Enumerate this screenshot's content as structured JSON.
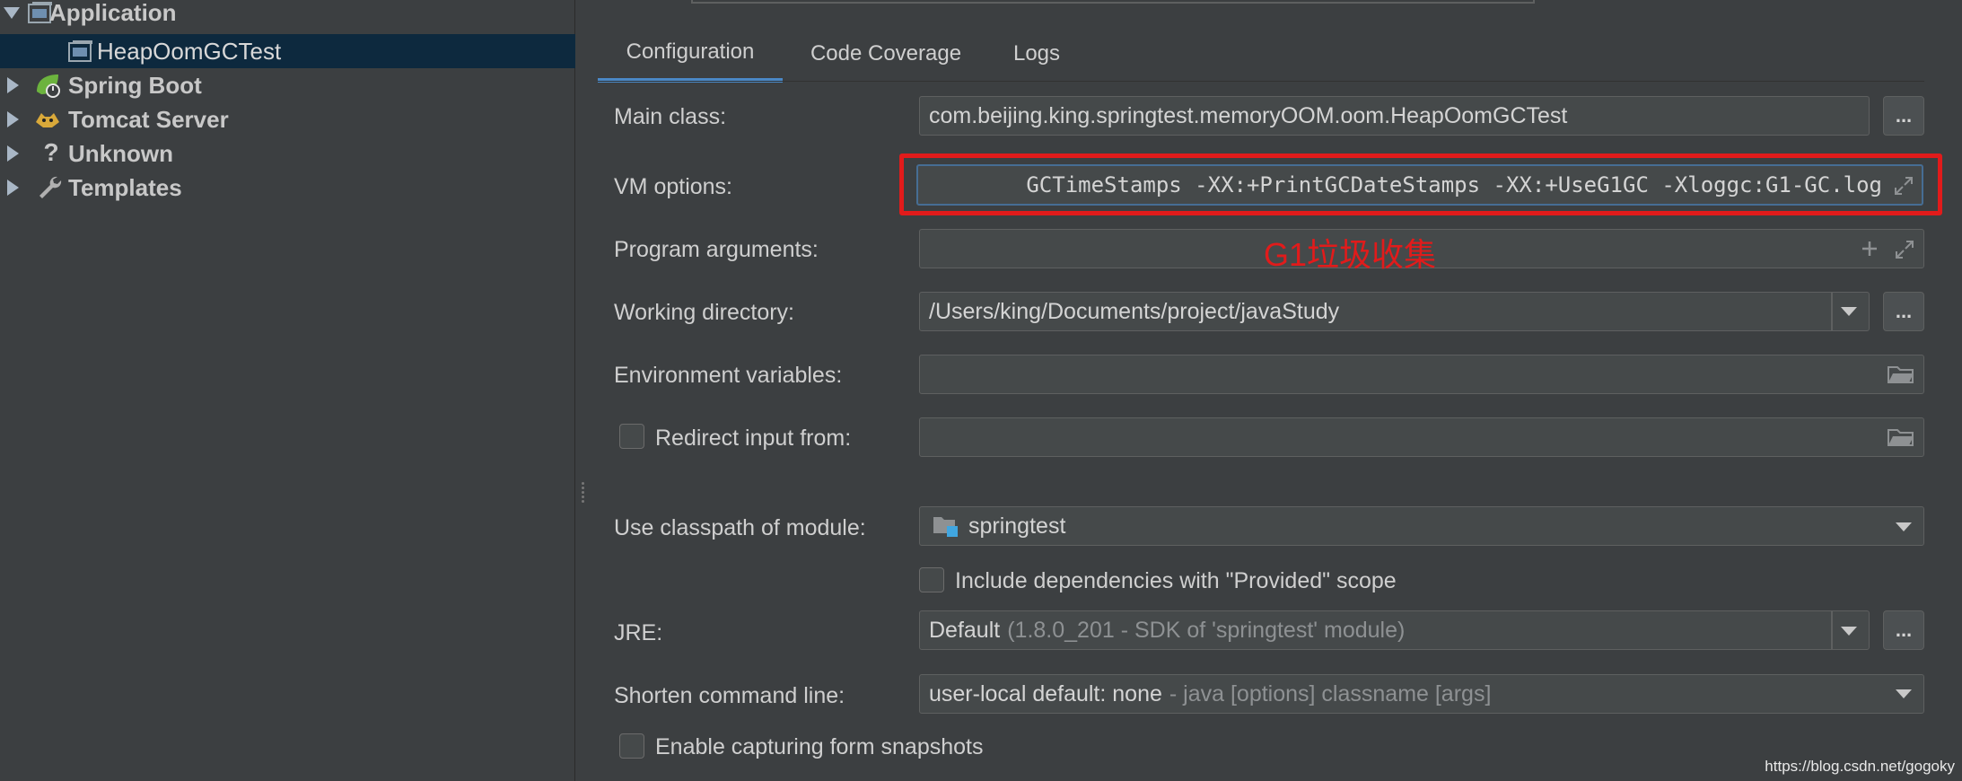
{
  "tree": {
    "items": [
      {
        "label": "Application",
        "icon": "application-icon",
        "expanded": true
      },
      {
        "label": "HeapOomGCTest",
        "icon": "application-config-icon",
        "selected": true
      },
      {
        "label": "Spring Boot",
        "icon": "spring-boot-icon",
        "expanded": false
      },
      {
        "label": "Tomcat Server",
        "icon": "tomcat-icon",
        "expanded": false
      },
      {
        "label": "Unknown",
        "icon": "question-icon",
        "expanded": false
      },
      {
        "label": "Templates",
        "icon": "wrench-icon",
        "expanded": false
      }
    ]
  },
  "tabs": [
    {
      "label": "Configuration",
      "active": true
    },
    {
      "label": "Code Coverage",
      "active": false
    },
    {
      "label": "Logs",
      "active": false
    }
  ],
  "form": {
    "main_class": {
      "label": "Main class:",
      "value": "com.beijing.king.springtest.memoryOOM.oom.HeapOomGCTest"
    },
    "vm_options": {
      "label": "VM options:",
      "value": "GCTimeStamps -XX:+PrintGCDateStamps -XX:+UseG1GC  -Xloggc:G1-GC.log"
    },
    "program_args": {
      "label": "Program arguments:",
      "value": ""
    },
    "working_dir": {
      "label": "Working directory:",
      "value": "/Users/king/Documents/project/javaStudy"
    },
    "env_vars": {
      "label": "Environment variables:",
      "value": ""
    },
    "redirect_input": {
      "label": "Redirect input from:",
      "checked": false,
      "value": ""
    },
    "classpath_module": {
      "label": "Use classpath of module:",
      "value": "springtest"
    },
    "include_provided": {
      "label": "Include dependencies with \"Provided\" scope",
      "checked": false
    },
    "jre": {
      "label": "JRE:",
      "value": "Default",
      "detail": "(1.8.0_201 - SDK of 'springtest' module)"
    },
    "shorten_cmd": {
      "label": "Shorten command line:",
      "value": "user-local default: none",
      "detail": "- java [options] classname [args]"
    },
    "form_snapshots": {
      "label": "Enable capturing form snapshots",
      "checked": false
    }
  },
  "annotation": "G1垃圾收集",
  "buttons": {
    "ellipsis": "..."
  },
  "watermark": "https://blog.csdn.net/gogoky",
  "colors": {
    "background": "#3c3f41",
    "selection": "#0d293e",
    "accent_tab": "#4a88c7",
    "highlight_border": "#e11b1b",
    "annotation_text": "#e11b1b"
  }
}
